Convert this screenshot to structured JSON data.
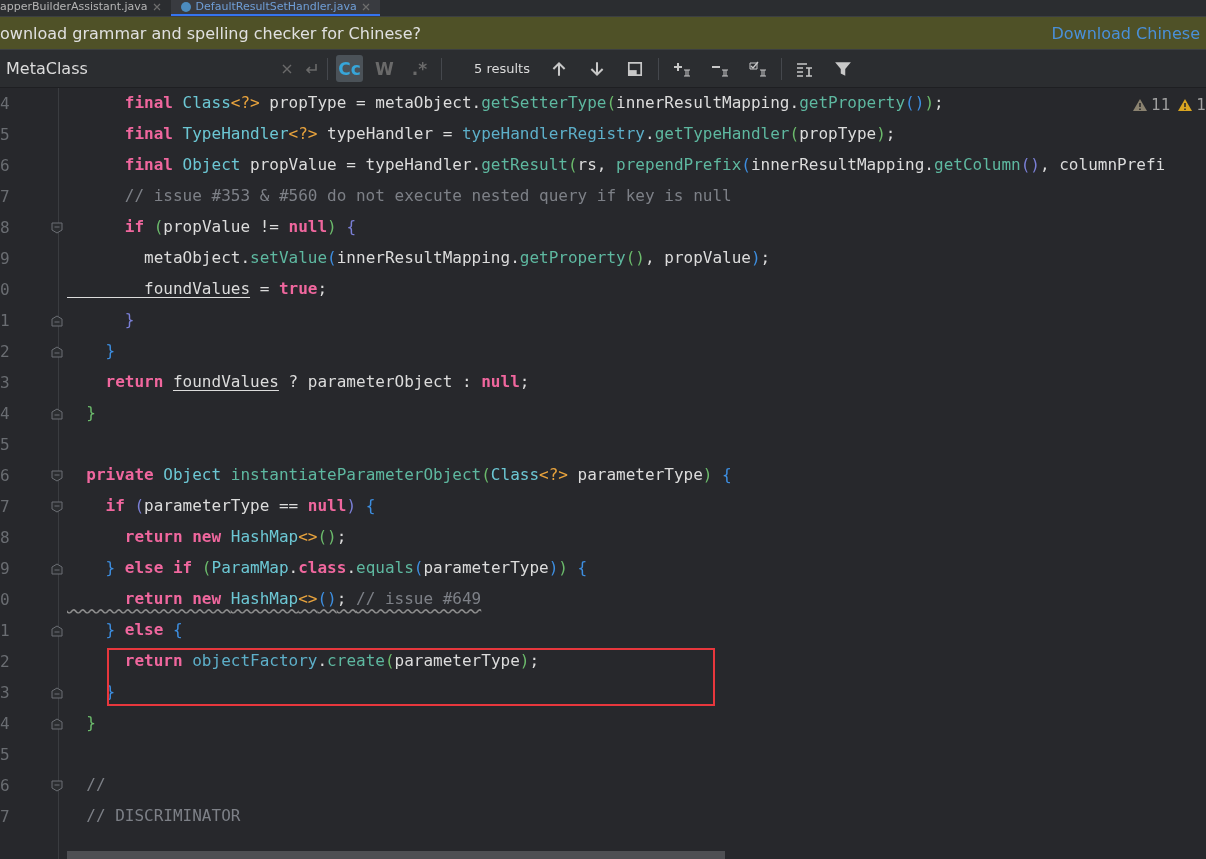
{
  "tabs": [
    {
      "label": "apperBuilderAssistant.java",
      "selected": false
    },
    {
      "label": "DefaultResultSetHandler.java",
      "selected": true
    }
  ],
  "banner": {
    "message": "ownload grammar and spelling checker for Chinese?",
    "link": "Download Chinese"
  },
  "find_bar": {
    "value": "MetaClass",
    "options": [
      {
        "label": "Cc",
        "selected": true
      },
      {
        "label": "W",
        "selected": false
      },
      {
        "label": ".*",
        "selected": false
      }
    ],
    "results": "5 results"
  },
  "inspections": [
    {
      "count": "11",
      "color": "#8a8270"
    },
    {
      "count": "1",
      "color": "#d9a521"
    }
  ],
  "lines": [
    {
      "num": "4",
      "tokens": [
        {
          "t": "      final ",
          "kind": "keyword"
        },
        {
          "t": "Class",
          "kind": "type"
        },
        {
          "t": "<?>",
          "kind": "generic"
        },
        {
          "t": " propType = metaObject.",
          "kind": "plain"
        },
        {
          "t": "getSetterType",
          "kind": "method"
        },
        {
          "t": "(",
          "kind": "paren1"
        },
        {
          "t": "innerResultMapping.",
          "kind": "plain"
        },
        {
          "t": "getProperty",
          "kind": "method"
        },
        {
          "t": "()",
          "kind": "paren2"
        },
        {
          "t": ")",
          "kind": "paren1"
        },
        {
          "t": ";",
          "kind": "plain"
        }
      ]
    },
    {
      "num": "5",
      "tokens": [
        {
          "t": "      final ",
          "kind": "keyword"
        },
        {
          "t": "TypeHandler",
          "kind": "type"
        },
        {
          "t": "<?>",
          "kind": "generic"
        },
        {
          "t": " typeHandler = ",
          "kind": "plain"
        },
        {
          "t": "typeHandlerRegistry",
          "kind": "member"
        },
        {
          "t": ".",
          "kind": "plain"
        },
        {
          "t": "getTypeHandler",
          "kind": "method"
        },
        {
          "t": "(",
          "kind": "paren1"
        },
        {
          "t": "propType",
          "kind": "plain"
        },
        {
          "t": ")",
          "kind": "paren1"
        },
        {
          "t": ";",
          "kind": "plain"
        }
      ]
    },
    {
      "num": "6",
      "tokens": [
        {
          "t": "      final ",
          "kind": "keyword"
        },
        {
          "t": "Object",
          "kind": "type"
        },
        {
          "t": " propValue = typeHandler.",
          "kind": "plain"
        },
        {
          "t": "getResult",
          "kind": "method"
        },
        {
          "t": "(",
          "kind": "paren1"
        },
        {
          "t": "rs, ",
          "kind": "plain"
        },
        {
          "t": "prependPrefix",
          "kind": "method"
        },
        {
          "t": "(",
          "kind": "paren2"
        },
        {
          "t": "innerResultMapping.",
          "kind": "plain"
        },
        {
          "t": "getColumn",
          "kind": "method"
        },
        {
          "t": "()",
          "kind": "paren3"
        },
        {
          "t": ", columnPrefi",
          "kind": "plain"
        }
      ]
    },
    {
      "num": "7",
      "tokens": [
        {
          "t": "      // issue #353 & #560 do not execute nested query if key is null",
          "kind": "comment"
        }
      ]
    },
    {
      "num": "8",
      "fold": {
        "kind": "start"
      },
      "tokens": [
        {
          "t": "      if ",
          "kind": "keyword"
        },
        {
          "t": "(",
          "kind": "paren1"
        },
        {
          "t": "propValue != ",
          "kind": "plain"
        },
        {
          "t": "null",
          "kind": "keyword"
        },
        {
          "t": ")",
          "kind": "paren1"
        },
        {
          "t": " {",
          "kind": "paren3"
        }
      ]
    },
    {
      "num": "9",
      "tokens": [
        {
          "t": "        metaObject.",
          "kind": "plain"
        },
        {
          "t": "setValue",
          "kind": "method"
        },
        {
          "t": "(",
          "kind": "paren2"
        },
        {
          "t": "innerResultMapping.",
          "kind": "plain"
        },
        {
          "t": "getProperty",
          "kind": "method"
        },
        {
          "t": "()",
          "kind": "paren1"
        },
        {
          "t": ", propValue",
          "kind": "plain"
        },
        {
          "t": ")",
          "kind": "paren2"
        },
        {
          "t": ";",
          "kind": "plain"
        }
      ]
    },
    {
      "num": "0",
      "tokens": [
        {
          "t": "        foundValues",
          "kind": "field"
        },
        {
          "t": " = ",
          "kind": "plain"
        },
        {
          "t": "true",
          "kind": "keyword"
        },
        {
          "t": ";",
          "kind": "plain"
        }
      ]
    },
    {
      "num": "1",
      "fold": {
        "kind": "end"
      },
      "tokens": [
        {
          "t": "      }",
          "kind": "paren3"
        }
      ]
    },
    {
      "num": "2",
      "fold": {
        "kind": "end"
      },
      "tokens": [
        {
          "t": "    }",
          "kind": "paren2"
        }
      ]
    },
    {
      "num": "3",
      "tokens": [
        {
          "t": "    return ",
          "kind": "keyword"
        },
        {
          "t": "foundValues",
          "kind": "field"
        },
        {
          "t": " ? parameterObject : ",
          "kind": "plain"
        },
        {
          "t": "null",
          "kind": "keyword"
        },
        {
          "t": ";",
          "kind": "plain"
        }
      ]
    },
    {
      "num": "4",
      "fold": {
        "kind": "end"
      },
      "tokens": [
        {
          "t": "  }",
          "kind": "paren1"
        }
      ]
    },
    {
      "num": "5"
    },
    {
      "num": "6",
      "fold": {
        "kind": "start"
      },
      "tokens": [
        {
          "t": "  private ",
          "kind": "keyword"
        },
        {
          "t": "Object ",
          "kind": "type"
        },
        {
          "t": "instantiateParameterObject",
          "kind": "method"
        },
        {
          "t": "(",
          "kind": "paren1"
        },
        {
          "t": "Class",
          "kind": "type"
        },
        {
          "t": "<?>",
          "kind": "generic"
        },
        {
          "t": " parameterType",
          "kind": "plain"
        },
        {
          "t": ")",
          "kind": "paren1"
        },
        {
          "t": " {",
          "kind": "paren2"
        }
      ]
    },
    {
      "num": "7",
      "fold": {
        "kind": "start"
      },
      "tokens": [
        {
          "t": "    if ",
          "kind": "keyword"
        },
        {
          "t": "(",
          "kind": "paren3"
        },
        {
          "t": "parameterType == ",
          "kind": "plain"
        },
        {
          "t": "null",
          "kind": "keyword"
        },
        {
          "t": ")",
          "kind": "paren3"
        },
        {
          "t": " {",
          "kind": "paren2"
        }
      ]
    },
    {
      "num": "8",
      "tokens": [
        {
          "t": "      return new ",
          "kind": "keyword"
        },
        {
          "t": "HashMap",
          "kind": "type"
        },
        {
          "t": "<>",
          "kind": "generic"
        },
        {
          "t": "()",
          "kind": "paren1"
        },
        {
          "t": ";",
          "kind": "plain"
        }
      ]
    },
    {
      "num": "9",
      "fold": {
        "kind": "end"
      },
      "tokens": [
        {
          "t": "    } ",
          "kind": "paren2"
        },
        {
          "t": "else if ",
          "kind": "keyword"
        },
        {
          "t": "(",
          "kind": "paren1"
        },
        {
          "t": "ParamMap",
          "kind": "type"
        },
        {
          "t": ".",
          "kind": "plain"
        },
        {
          "t": "class",
          "kind": "keyword"
        },
        {
          "t": ".",
          "kind": "plain"
        },
        {
          "t": "equals",
          "kind": "method"
        },
        {
          "t": "(",
          "kind": "paren2"
        },
        {
          "t": "parameterType",
          "kind": "plain"
        },
        {
          "t": ")",
          "kind": "paren2"
        },
        {
          "t": ")",
          "kind": "paren1"
        },
        {
          "t": " {",
          "kind": "paren2"
        }
      ]
    },
    {
      "num": "0",
      "squiggle": true,
      "tokens": [
        {
          "t": "      return new ",
          "kind": "keyword"
        },
        {
          "t": "HashMap",
          "kind": "type"
        },
        {
          "t": "<>",
          "kind": "generic"
        },
        {
          "t": "()",
          "kind": "paren2"
        },
        {
          "t": "; ",
          "kind": "plain"
        },
        {
          "t": "// issue #649",
          "kind": "comment"
        }
      ]
    },
    {
      "num": "1",
      "fold": {
        "kind": "end"
      },
      "tokens": [
        {
          "t": "    } ",
          "kind": "paren2"
        },
        {
          "t": "else ",
          "kind": "keyword"
        },
        {
          "t": "{",
          "kind": "paren2"
        }
      ]
    },
    {
      "num": "2",
      "boxed": true,
      "tokens": [
        {
          "t": "      return ",
          "kind": "keyword"
        },
        {
          "t": "objectFactory",
          "kind": "member"
        },
        {
          "t": ".",
          "kind": "plain"
        },
        {
          "t": "create",
          "kind": "method"
        },
        {
          "t": "(",
          "kind": "paren1"
        },
        {
          "t": "parameterType",
          "kind": "plain"
        },
        {
          "t": ")",
          "kind": "paren1"
        },
        {
          "t": ";",
          "kind": "plain"
        }
      ]
    },
    {
      "num": "3",
      "fold": {
        "kind": "end"
      },
      "boxed": true,
      "tokens": [
        {
          "t": "    }",
          "kind": "paren2"
        }
      ]
    },
    {
      "num": "4",
      "fold": {
        "kind": "end"
      },
      "tokens": [
        {
          "t": "  }",
          "kind": "paren1"
        }
      ]
    },
    {
      "num": "5"
    },
    {
      "num": "6",
      "fold": {
        "kind": "start"
      },
      "tokens": [
        {
          "t": "  //",
          "kind": "comment"
        }
      ]
    },
    {
      "num": "7",
      "tokens": [
        {
          "t": "  // DISCRIMINATOR",
          "kind": "comment"
        }
      ]
    }
  ]
}
